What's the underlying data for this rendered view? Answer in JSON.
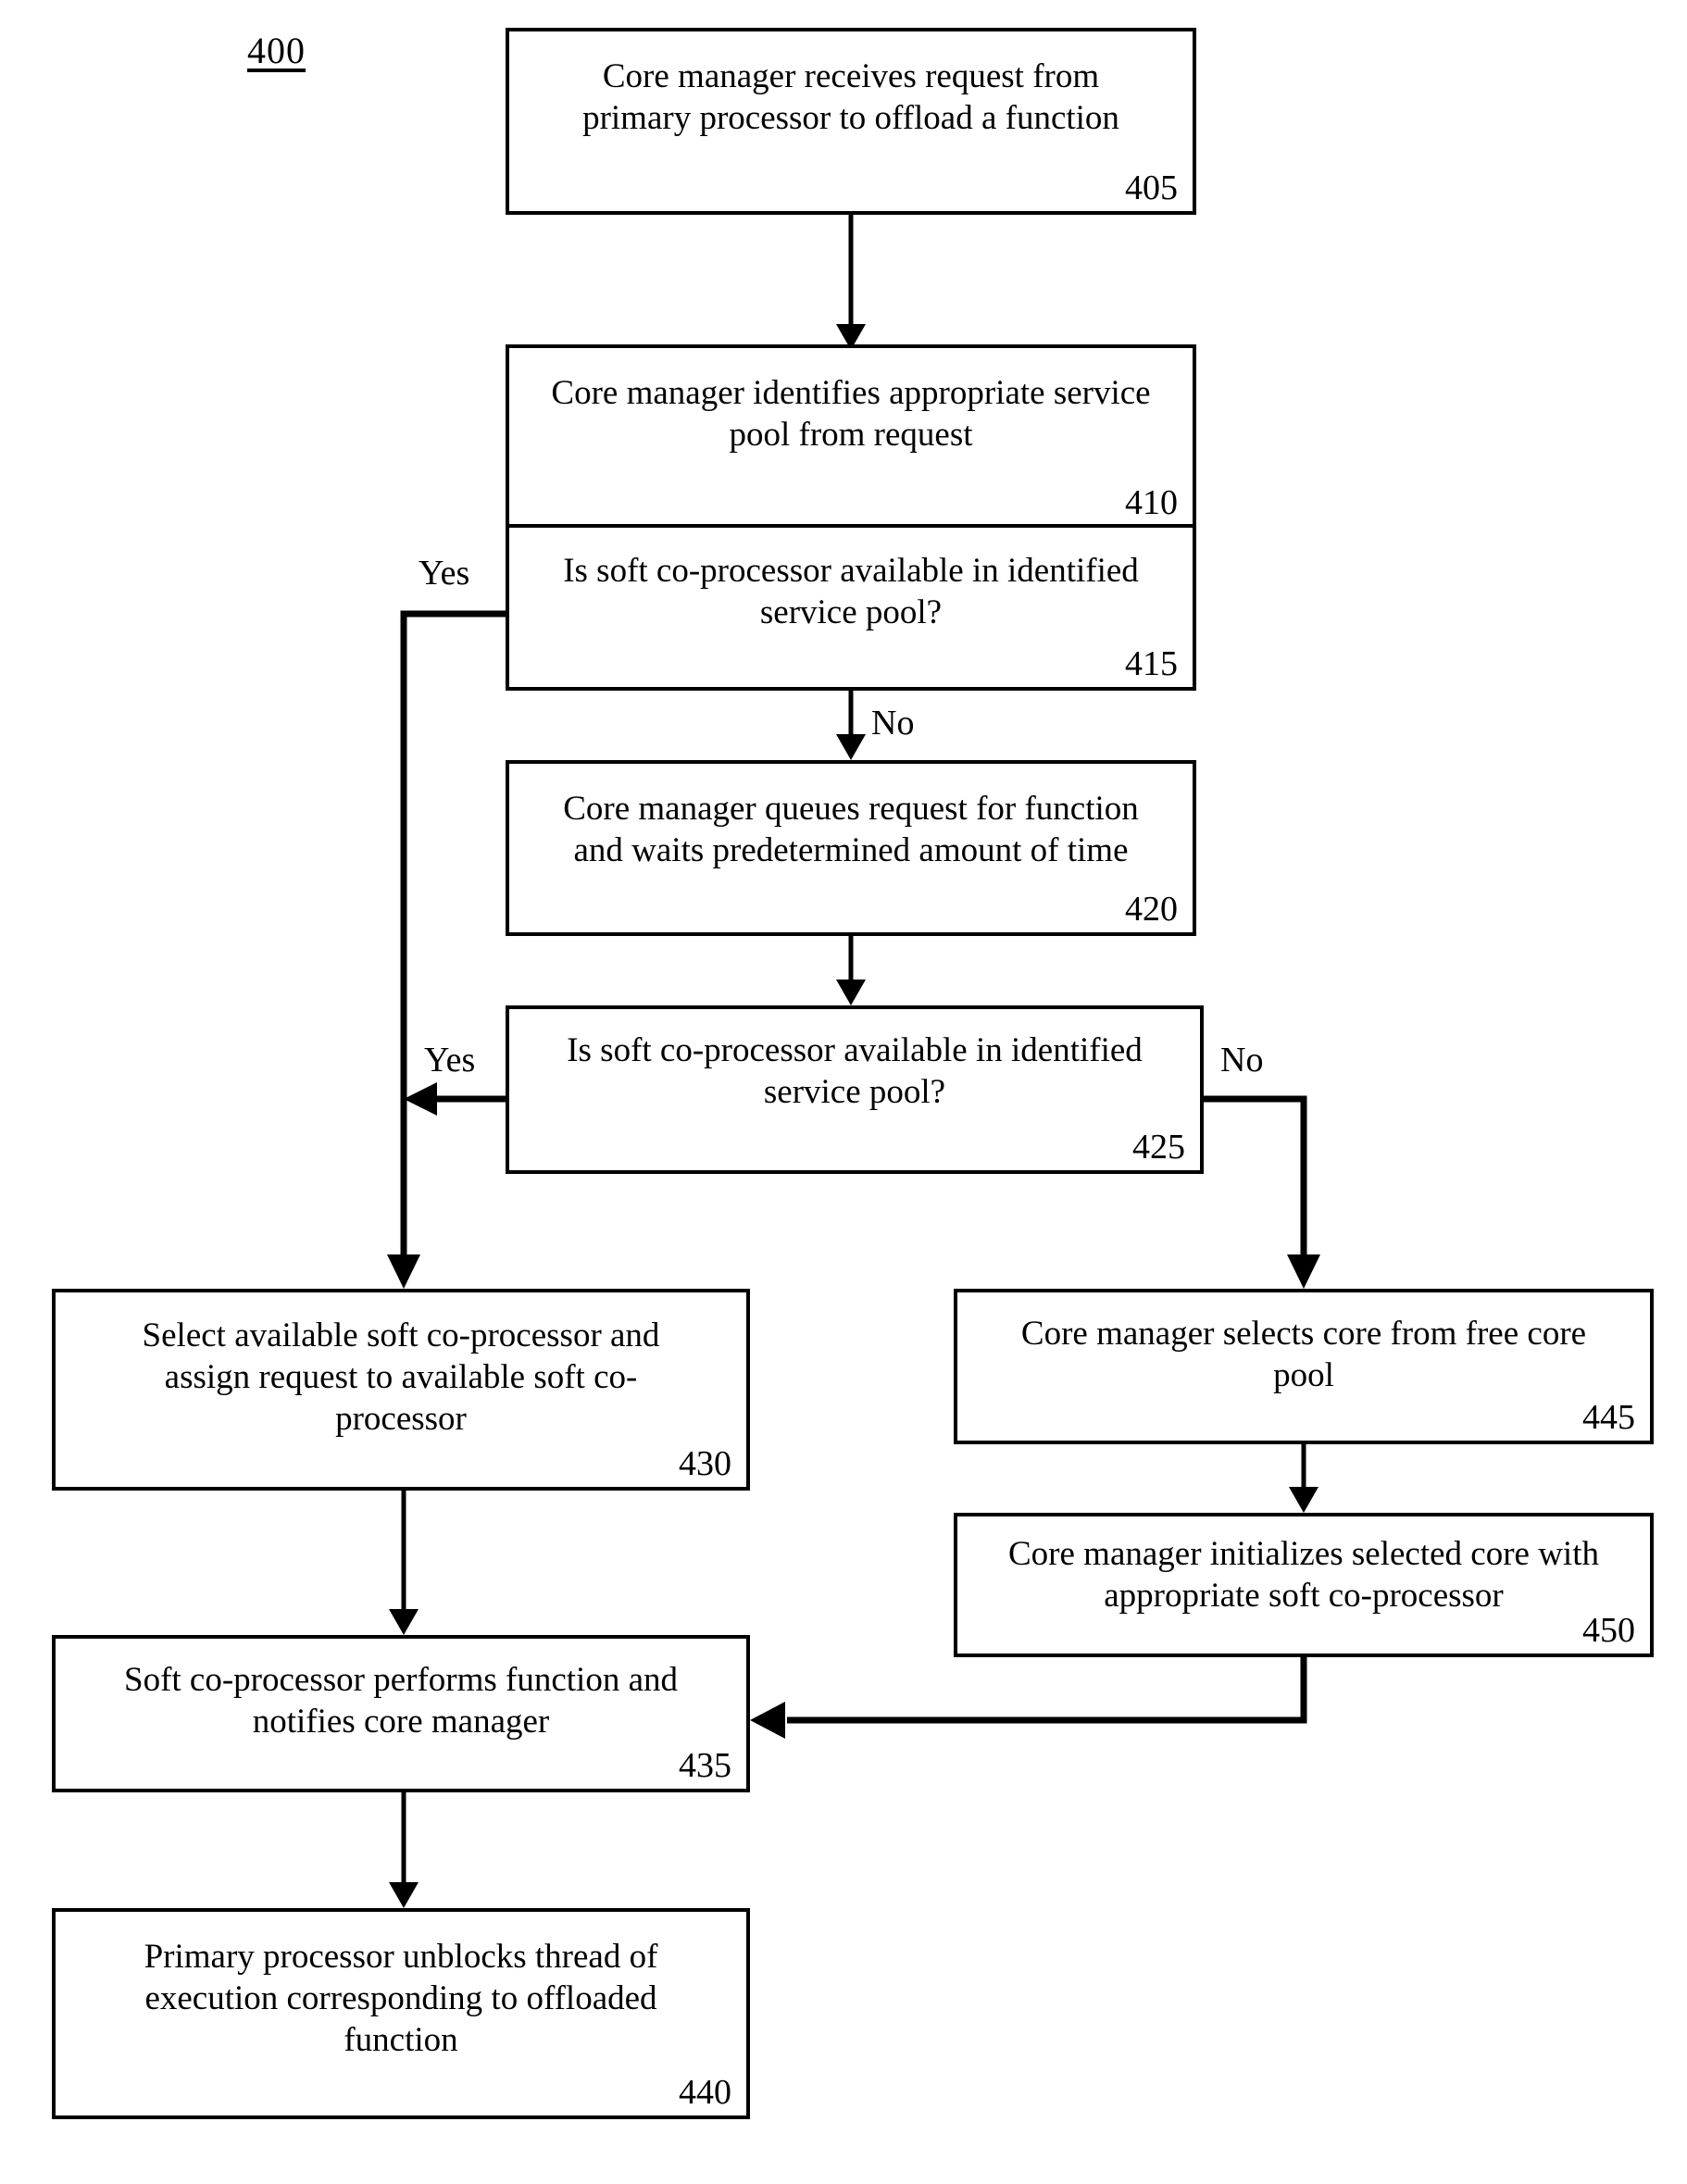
{
  "figure": {
    "number": "400"
  },
  "nodes": [
    {
      "id": "n405",
      "ref": "405",
      "text": "Core manager receives request from primary processor to offload a function",
      "lines": [
        "Core manager receives request from",
        "primary processor to offload a function"
      ]
    },
    {
      "id": "n410",
      "ref": "410",
      "text": "Core manager identifies appropriate service pool from request",
      "lines": [
        "Core manager identifies appropriate service",
        "pool from request"
      ]
    },
    {
      "id": "n415",
      "ref": "415",
      "text": "Is soft co-processor available in identified service pool?",
      "lines": [
        "Is soft co-processor available in identified",
        "service pool?"
      ]
    },
    {
      "id": "n420",
      "ref": "420",
      "text": "Core manager queues request for function and waits predetermined amount of time",
      "lines": [
        "Core manager queues request for function",
        "and waits predetermined amount of time"
      ]
    },
    {
      "id": "n425",
      "ref": "425",
      "text": "Is soft co-processor available in identified service pool?",
      "lines": [
        "Is soft co-processor available in identified",
        "service pool?"
      ]
    },
    {
      "id": "n430",
      "ref": "430",
      "text": "Select available soft co-processor and assign request to available soft co-processor",
      "lines": [
        "Select available soft co-processor and",
        "assign request to available soft co-",
        "processor"
      ]
    },
    {
      "id": "n435",
      "ref": "435",
      "text": "Soft co-processor performs function and notifies core manager",
      "lines": [
        "Soft co-processor performs function and",
        "notifies core manager"
      ]
    },
    {
      "id": "n440",
      "ref": "440",
      "text": "Primary processor unblocks thread of execution corresponding to offloaded function",
      "lines": [
        "Primary processor unblocks thread of",
        "execution corresponding to offloaded",
        "function"
      ]
    },
    {
      "id": "n445",
      "ref": "445",
      "text": "Core manager selects core from free core pool",
      "lines": [
        "Core manager selects core from free core",
        "pool"
      ]
    },
    {
      "id": "n450",
      "ref": "450",
      "text": "Core manager initializes selected core with appropriate soft co-processor",
      "lines": [
        "Core manager initializes selected core with",
        "appropriate soft co-processor"
      ]
    }
  ],
  "edge_labels": {
    "yes_415": "Yes",
    "no_415": "No",
    "yes_425": "Yes",
    "no_425": "No"
  },
  "style": {
    "stroke": "#000000",
    "fill": "#ffffff"
  }
}
